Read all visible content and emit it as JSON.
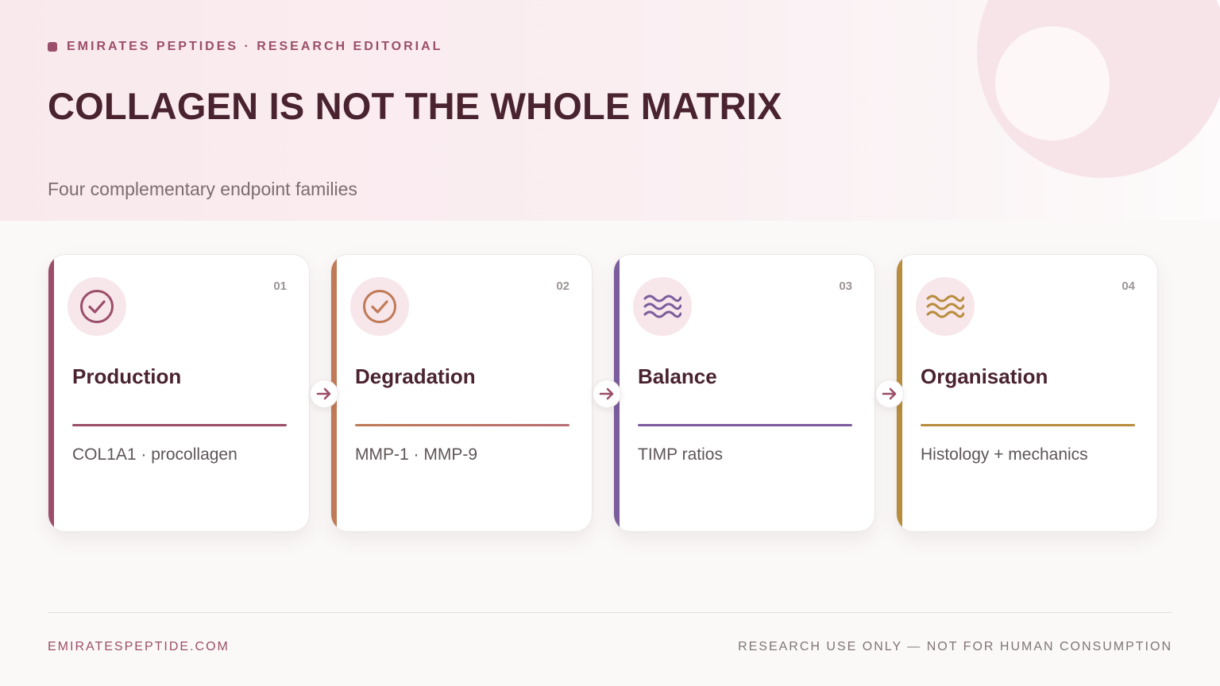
{
  "header": {
    "eyebrow": "EMIRATES PEPTIDES · RESEARCH EDITORIAL",
    "title": "COLLAGEN IS NOT THE WHOLE MATRIX",
    "subtitle": "Four complementary endpoint families"
  },
  "cards": [
    {
      "number": "01",
      "title": "Production",
      "desc": "COL1A1 · procollagen",
      "icon": "check-circle-icon",
      "color": "#9b4e69"
    },
    {
      "number": "02",
      "title": "Degradation",
      "desc": "MMP-1 · MMP-9",
      "icon": "check-circle-icon",
      "color": "#c07a57"
    },
    {
      "number": "03",
      "title": "Balance",
      "desc": "TIMP ratios",
      "icon": "waves-icon",
      "color": "#7b5c9c"
    },
    {
      "number": "04",
      "title": "Organisation",
      "desc": "Histology + mechanics",
      "icon": "waves-icon",
      "color": "#b88c3c"
    }
  ],
  "connector": {
    "icon": "arrow-right-icon",
    "color": "#9b4e69"
  },
  "footer": {
    "site": "EMIRATESPEPTIDE.COM",
    "disclaimer": "RESEARCH USE ONLY — NOT FOR HUMAN CONSUMPTION"
  }
}
